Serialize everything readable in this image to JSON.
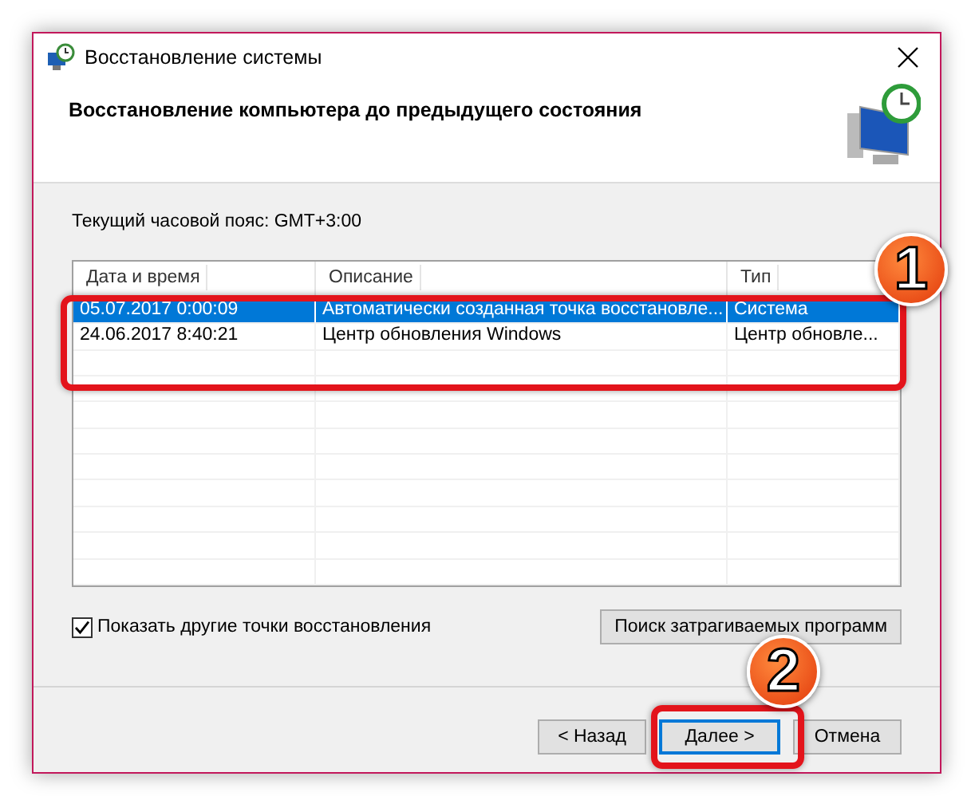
{
  "window": {
    "title": "Восстановление системы"
  },
  "header": {
    "heading": "Восстановление компьютера до предыдущего состояния"
  },
  "timezone": "Текущий часовой пояс: GMT+3:00",
  "table": {
    "columns": [
      "Дата и время",
      "Описание",
      "Тип"
    ],
    "rows": [
      {
        "cells": [
          "05.07.2017 0:00:09",
          "Автоматически созданная точка восстановле...",
          "Система"
        ],
        "selected": true
      },
      {
        "cells": [
          "24.06.2017 8:40:21",
          "Центр обновления Windows",
          "Центр обновле..."
        ],
        "selected": false
      }
    ]
  },
  "show_more": {
    "label": "Показать другие точки восстановления",
    "checked": true
  },
  "scan_button": "Поиск затрагиваемых программ",
  "buttons": [
    {
      "label": "< Назад",
      "focused": false
    },
    {
      "label": "Далее >",
      "focused": true
    },
    {
      "label": "Отмена",
      "focused": false
    }
  ],
  "annotations": [
    {
      "label": "1"
    },
    {
      "label": "2"
    }
  ]
}
